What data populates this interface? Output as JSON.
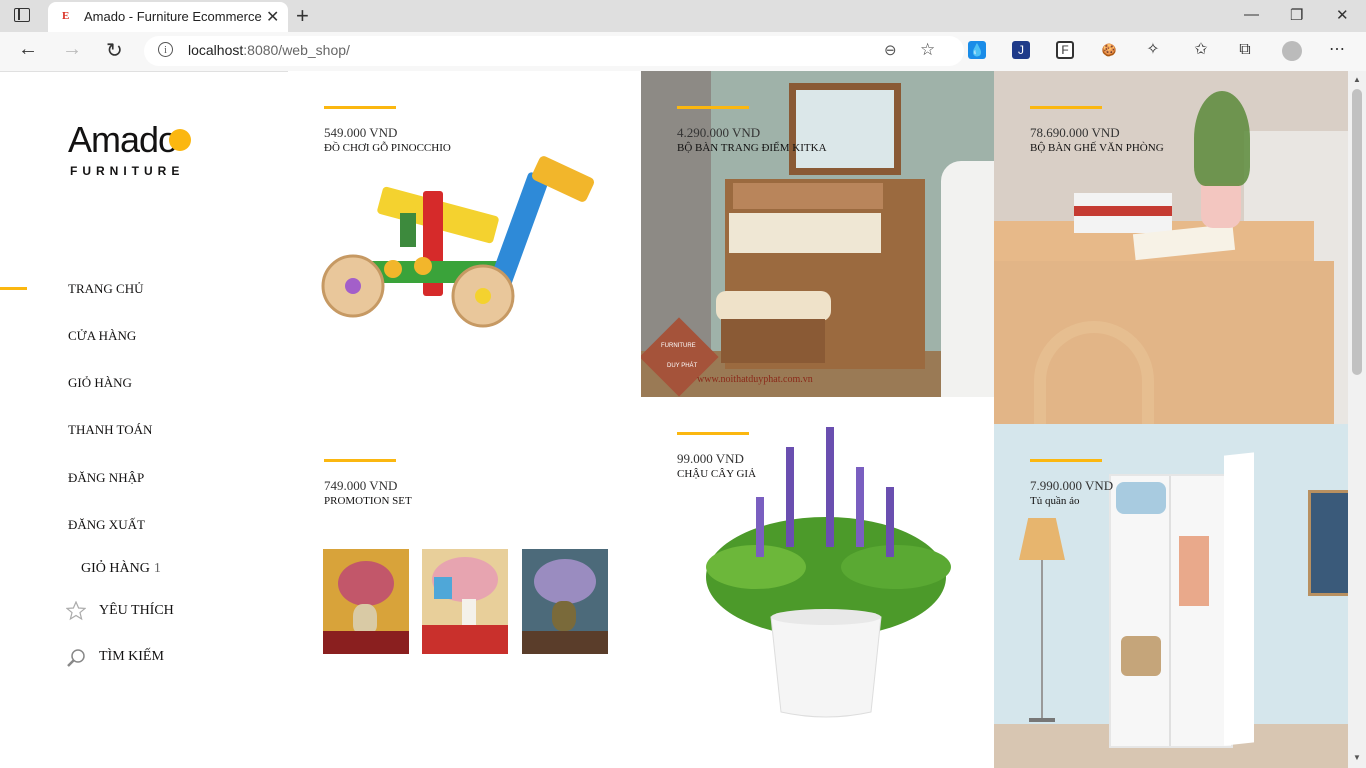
{
  "browser": {
    "tab_title": "Amado - Furniture Ecommerce T",
    "tab_favicon": "E",
    "url_host": "localhost",
    "url_rest": ":8080/web_shop/",
    "icons": [
      "sidebar-toggle-icon",
      "close-icon",
      "plus-icon",
      "minimize-icon",
      "restore-icon",
      "window-close-icon",
      "back-icon",
      "forward-icon",
      "refresh-icon",
      "info-icon",
      "zoom-icon",
      "add-favorite-icon",
      "extension-drop-icon",
      "extension-j-icon",
      "extension-f-icon",
      "cookie-icon",
      "puzzle-icon",
      "favorites-icon",
      "collections-icon",
      "profile-icon",
      "more-icon"
    ]
  },
  "brand": {
    "name": "Amado",
    "sub": "FURNITURE",
    "accent": "#fbb710"
  },
  "nav": {
    "items": [
      {
        "label": "TRANG CHỦ"
      },
      {
        "label": "CỬA HÀNG"
      },
      {
        "label": "GIỎ HÀNG"
      },
      {
        "label": "THANH TOÁN"
      },
      {
        "label": "ĐĂNG NHẬP"
      },
      {
        "label": "ĐĂNG XUẤT"
      }
    ]
  },
  "sidebar_extras": {
    "cart_label": "GIỎ HÀNG",
    "cart_count": "1",
    "favorite_label": "YÊU THÍCH",
    "search_label": "TÌM KIẾM"
  },
  "products": [
    {
      "price": "549.000 VND",
      "name": "ĐỒ CHƠI GỖ PINOCCHIO"
    },
    {
      "price": "4.290.000 VND",
      "name": "BỘ BÀN TRANG ĐIỂM KITKA"
    },
    {
      "price": "78.690.000 VND",
      "name": "BỘ BÀN GHẾ VĂN PHÒNG"
    },
    {
      "price": "749.000 VND",
      "name": "PROMOTION SET"
    },
    {
      "price": "99.000 VND",
      "name": "CHẬU CÂY GIẢ"
    },
    {
      "price": "7.990.000 VND",
      "name": "Tủ quần áo"
    }
  ],
  "watermark": {
    "text": "www.noithatduyphat.com.vn",
    "badge_top": "FURNITURE",
    "badge_bottom": "DUY PHÁT"
  }
}
